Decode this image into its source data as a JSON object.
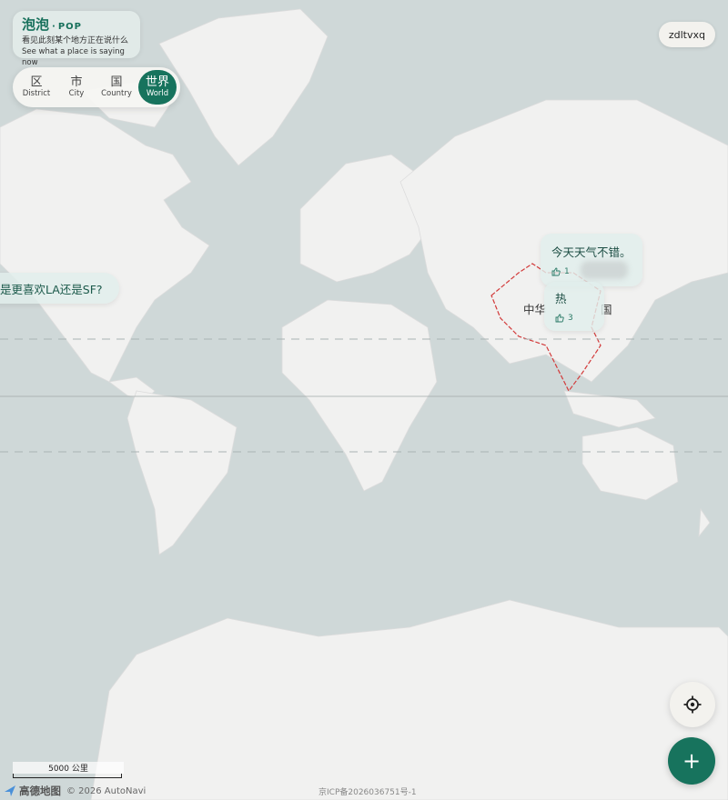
{
  "brand": {
    "title": "泡泡",
    "separator": "·",
    "tag": "POP",
    "subtitle_cn": "看见此刻某个地方正在说什么",
    "subtitle_en": "See what a place is saying now"
  },
  "scope_tabs": [
    {
      "cn": "区",
      "en": "District",
      "active": false
    },
    {
      "cn": "市",
      "en": "City",
      "active": false
    },
    {
      "cn": "国",
      "en": "Country",
      "active": false
    },
    {
      "cn": "世界",
      "en": "World",
      "active": true
    }
  ],
  "user": {
    "name": "zdltvxq"
  },
  "map": {
    "country_label": "中华",
    "country_label_tail": "国",
    "colors": {
      "water": "#cfd8d8",
      "land": "#f1f1f0",
      "border_highlight": "#d23a3a",
      "accent": "#17735d"
    }
  },
  "bubbles": [
    {
      "text": "是更喜欢LA还是SF?"
    },
    {
      "text": "今天天气不错。",
      "likes": "1"
    },
    {
      "text": "热",
      "likes": "3"
    }
  ],
  "controls": {
    "locate_icon": "crosshair-icon",
    "add_label": "+"
  },
  "scale": {
    "label": "5000 公里"
  },
  "attribution": {
    "provider": "高德地图",
    "copyright": "© 2026 AutoNavi",
    "icp": "京ICP备2026036751号-1"
  }
}
